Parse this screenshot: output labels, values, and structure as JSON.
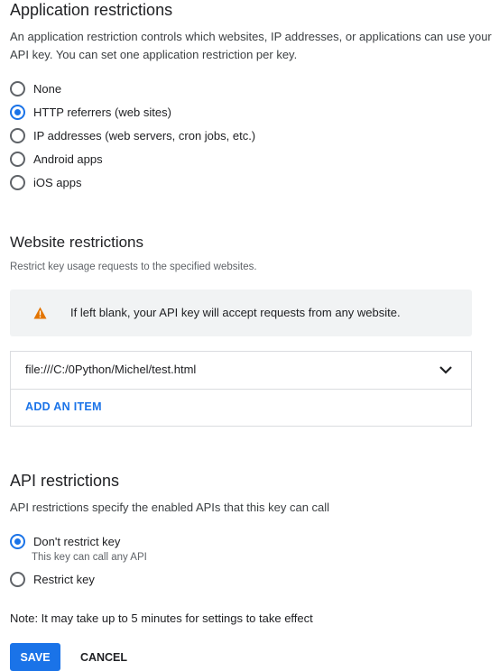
{
  "app_restrictions": {
    "title": "Application restrictions",
    "description_line1": "An application restriction controls which websites, IP addresses, or applications can use your",
    "description_line2": "API key. You can set one application restriction per key.",
    "options": [
      {
        "label": "None",
        "selected": false
      },
      {
        "label": "HTTP referrers (web sites)",
        "selected": true
      },
      {
        "label": "IP addresses (web servers, cron jobs, etc.)",
        "selected": false
      },
      {
        "label": "Android apps",
        "selected": false
      },
      {
        "label": "iOS apps",
        "selected": false
      }
    ]
  },
  "website_restrictions": {
    "title": "Website restrictions",
    "description": "Restrict key usage requests to the specified websites.",
    "warning": "If left blank, your API key will accept requests from any website.",
    "warning_icon": "warning-triangle-icon",
    "items": [
      {
        "value": "file:///C:/0Python/Michel/test.html"
      }
    ],
    "add_item_label": "ADD AN ITEM"
  },
  "api_restrictions": {
    "title": "API restrictions",
    "description": "API restrictions specify the enabled APIs that this key can call",
    "options": [
      {
        "label": "Don't restrict key",
        "sublabel": "This key can call any API",
        "selected": true
      },
      {
        "label": "Restrict key",
        "selected": false
      }
    ]
  },
  "note": "Note: It may take up to 5 minutes for settings to take effect",
  "actions": {
    "save_label": "SAVE",
    "cancel_label": "CANCEL"
  },
  "colors": {
    "accent": "#1a73e8",
    "warning": "#e37400"
  }
}
